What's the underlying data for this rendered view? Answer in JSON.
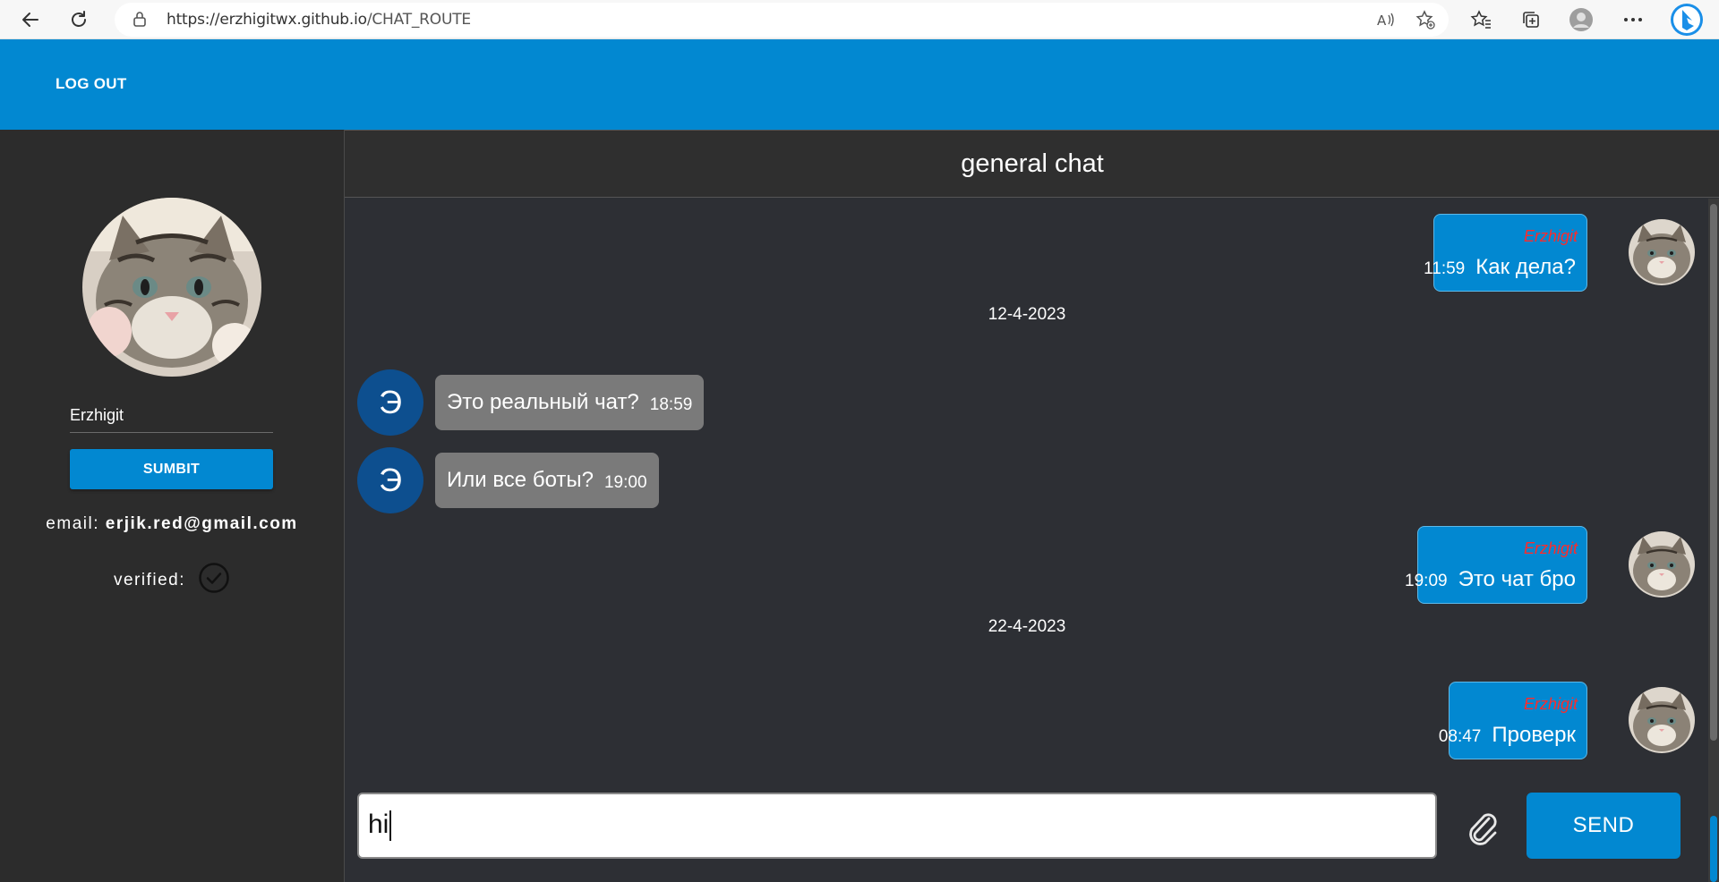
{
  "browser": {
    "url_host": "https://erzhigitwx.github.io",
    "url_path": "/CHAT_ROUTE",
    "icons": [
      "back-icon",
      "refresh-icon",
      "lock-icon",
      "read-aloud-icon",
      "add-favorite-icon",
      "favorites-icon",
      "collections-icon",
      "profile-icon",
      "more-icon",
      "bing-icon"
    ]
  },
  "header": {
    "logout_label": "LOG OUT"
  },
  "sidebar": {
    "name_value": "Erzhigit",
    "submit_label": "SUMBIT",
    "email_label": "email:",
    "email_value": "erjik.red@gmail.com",
    "verified_label": "verified:"
  },
  "chat": {
    "title": "general chat",
    "messages": [
      {
        "author": "Erzhigit",
        "time": "11:59",
        "text": "Как дела?"
      },
      {
        "date": "12-4-2023"
      },
      {
        "avatar_letter": "Э",
        "text": "Это реальный чат?",
        "time": "18:59"
      },
      {
        "avatar_letter": "Э",
        "text": "Или все боты?",
        "time": "19:00"
      },
      {
        "author": "Erzhigit",
        "time": "19:09",
        "text": "Это чат бро"
      },
      {
        "date": "22-4-2023"
      },
      {
        "author": "Erzhigit",
        "time": "08:47",
        "text": "Проверк"
      }
    ],
    "composer": {
      "value": "hi",
      "send_label": "SEND"
    }
  },
  "colors": {
    "accent": "#0288d1",
    "sidebar_bg": "#2c2c2c",
    "chat_bg": "#2d2f34",
    "incoming_bubble": "#7a7a7a",
    "author_name": "#ff2b2b",
    "letter_avatar": "#0d4f8f"
  }
}
